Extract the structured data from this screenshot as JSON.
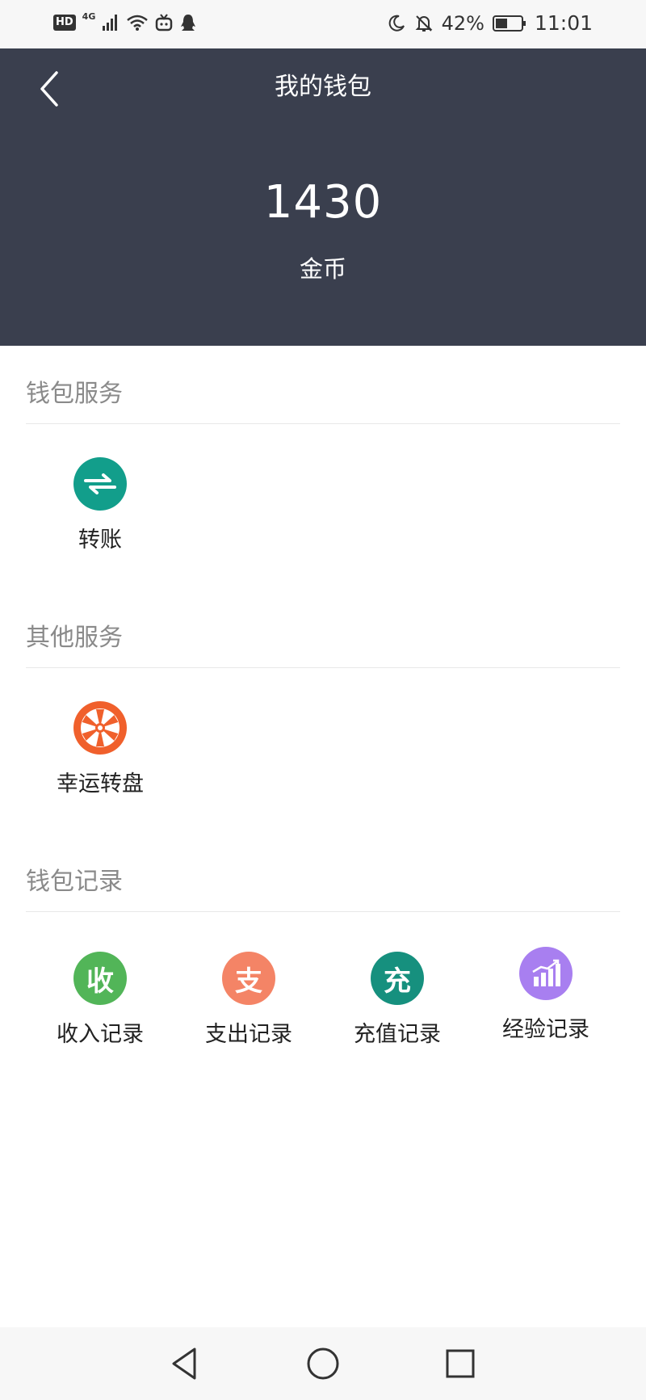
{
  "status_bar": {
    "hd": "HD",
    "network": "4G",
    "battery_percent": "42%",
    "time": "11:01",
    "icons": [
      "signal-icon",
      "wifi-icon",
      "tv-icon",
      "qq-icon",
      "moon-icon",
      "bell-off-icon",
      "battery-icon"
    ]
  },
  "header": {
    "title": "我的钱包",
    "balance": "1430",
    "unit": "金币",
    "bg_color": "#3a3f4e"
  },
  "sections": [
    {
      "title": "钱包服务",
      "items": [
        {
          "label": "转账",
          "icon": "transfer-icon",
          "color": "#129e8b"
        }
      ]
    },
    {
      "title": "其他服务",
      "items": [
        {
          "label": "幸运转盘",
          "icon": "wheel-icon",
          "color": "#f0602c"
        }
      ]
    },
    {
      "title": "钱包记录",
      "items": [
        {
          "label": "收入记录",
          "icon": "income-icon",
          "glyph": "收",
          "color": "#52b558"
        },
        {
          "label": "支出记录",
          "icon": "expense-icon",
          "glyph": "支",
          "color": "#f48466"
        },
        {
          "label": "充值记录",
          "icon": "recharge-icon",
          "glyph": "充",
          "color": "#16907e"
        },
        {
          "label": "经验记录",
          "icon": "chart-icon",
          "color": "#a87ff0"
        }
      ]
    }
  ]
}
